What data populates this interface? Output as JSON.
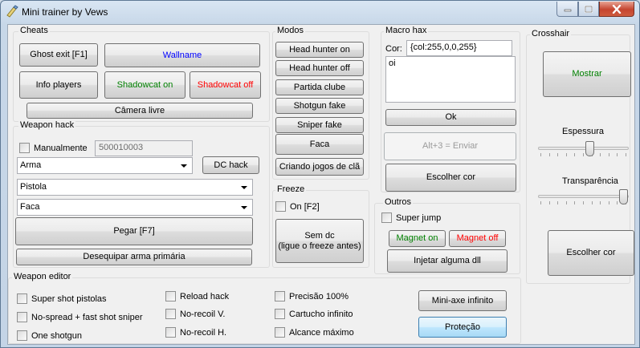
{
  "window": {
    "title": "Mini trainer by Vews"
  },
  "cheats": {
    "label": "Cheats",
    "ghost_exit": "Ghost exit [F1]",
    "wallname": "Wallname",
    "info_players": "Info players",
    "shadowcat_on": "Shadowcat on",
    "shadowcat_off": "Shadowcat off",
    "camera_livre": "Câmera livre"
  },
  "weapon_hack": {
    "label": "Weapon hack",
    "manual_label": "Manualmente",
    "manual_value": "500010003",
    "arma_select": "Arma",
    "dc_hack": "DC hack",
    "pistola_select": "Pistola",
    "faca_select": "Faca",
    "pegar": "Pegar [F7]",
    "desequipar": "Desequipar arma primária"
  },
  "modos": {
    "label": "Modos",
    "buttons": [
      "Head hunter on",
      "Head hunter off",
      "Partida clube",
      "Shotgun fake",
      "Sniper fake",
      "Faca",
      "Criando jogos de clã"
    ]
  },
  "freeze": {
    "label": "Freeze",
    "on_label": "On [F2]",
    "sem_dc": "Sem dc\n(ligue o freeze antes)"
  },
  "macro": {
    "label": "Macro hax",
    "cor_label": "Cor:",
    "cor_value": "{col:255,0,0,255}",
    "text": "oi",
    "ok": "Ok",
    "enviar": "Alt+3 = Enviar",
    "escolher_cor": "Escolher cor"
  },
  "outros": {
    "label": "Outros",
    "super_jump": "Super jump",
    "magnet_on": "Magnet on",
    "magnet_off": "Magnet off",
    "injetar": "Injetar alguma dll"
  },
  "crosshair": {
    "label": "Crosshair",
    "mostrar": "Mostrar",
    "espessura": "Espessura",
    "espessura_level": 0.57,
    "transparencia": "Transparência",
    "transparencia_level": 1.0,
    "escolher_cor": "Escolher cor"
  },
  "weapon_editor": {
    "label": "Weapon editor",
    "col1": [
      "Super shot pistolas",
      "No-spread + fast shot sniper",
      "One shotgun"
    ],
    "col2": [
      "Reload hack",
      "No-recoil V.",
      "No-recoil H."
    ],
    "col3": [
      "Precisão 100%",
      "Cartucho infinito",
      "Alcance máximo"
    ],
    "mini_axe": "Mini-axe infinito",
    "protecao": "Proteção"
  },
  "colors": {
    "green_text": "#008000",
    "red_text": "#ff0000",
    "blue_text": "#0000ff"
  },
  "icons": [
    "app-icon",
    "minimize-icon",
    "maximize-icon",
    "close-icon"
  ]
}
